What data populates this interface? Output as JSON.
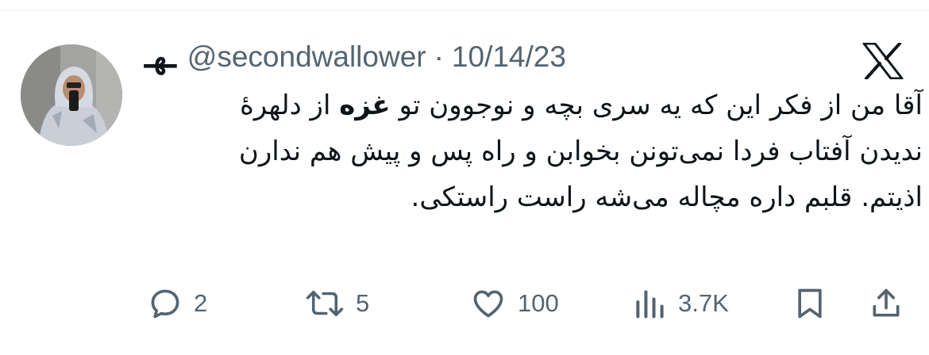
{
  "tweet": {
    "display_name": "ـهـ",
    "handle": "@secondwallower",
    "separator": "·",
    "date": "10/14/23",
    "text_before": "آقا من از فکر این که یه سری بچه و نوجوون تو ",
    "text_bold": "غزه",
    "text_after": " از دلهرهٔ ندیدن آفتاب فردا نمی‌تونن بخوابن و راه پس و پیش هم ندارن اذیتم. قلبم داره مچاله می‌شه راست راستکی."
  },
  "metrics": {
    "replies": "2",
    "reposts": "5",
    "likes": "100",
    "views": "3.7K"
  },
  "icons": {
    "brand": "x-logo-icon",
    "reply": "reply-icon",
    "repost": "repost-icon",
    "like": "heart-icon",
    "views": "views-icon",
    "bookmark": "bookmark-icon",
    "share": "share-icon"
  },
  "colors": {
    "text": "#0f1419",
    "secondary": "#536471",
    "background": "#ffffff"
  }
}
